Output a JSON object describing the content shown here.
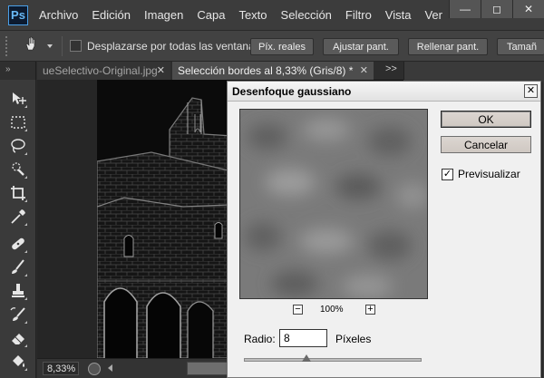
{
  "app": {
    "logo": "Ps"
  },
  "menu": [
    "Archivo",
    "Edición",
    "Imagen",
    "Capa",
    "Texto",
    "Selección",
    "Filtro",
    "Vista",
    "Ver"
  ],
  "window_controls": {
    "minimize": "—",
    "restore": "◻",
    "close": "✕"
  },
  "options_bar": {
    "scroll_all_label": "Desplazarse por todas las ventanas",
    "buttons": [
      "Píx. reales",
      "Ajustar pant.",
      "Rellenar pant.",
      "Tamañ"
    ]
  },
  "tabs": {
    "panel_collapse": "»",
    "items": [
      {
        "label": "ueSelectivo-Original.jpg",
        "close": "✕"
      },
      {
        "label": "Selección bordes al 8,33% (Gris/8) *",
        "close": "✕"
      }
    ],
    "overflow": ">>"
  },
  "tools": [
    "move-tool",
    "marquee-tool",
    "lasso-tool",
    "quick-selection-tool",
    "crop-tool",
    "eyedropper-tool",
    "healing-brush-tool",
    "brush-tool",
    "clone-stamp-tool",
    "history-brush-tool",
    "eraser-tool",
    "paint-bucket-tool"
  ],
  "status_bar": {
    "zoom": "8,33%"
  },
  "dialog": {
    "title": "Desenfoque gaussiano",
    "close": "✕",
    "zoom_out": "−",
    "zoom_in": "+",
    "zoom_level": "100%",
    "ok_label": "OK",
    "cancel_label": "Cancelar",
    "preview_label": "Previsualizar",
    "preview_checked": true,
    "preview_check": "✓",
    "radius_label": "Radio:",
    "radius_value": "8",
    "radius_unit": "Píxeles",
    "radius_slider_fraction": 0.35
  }
}
